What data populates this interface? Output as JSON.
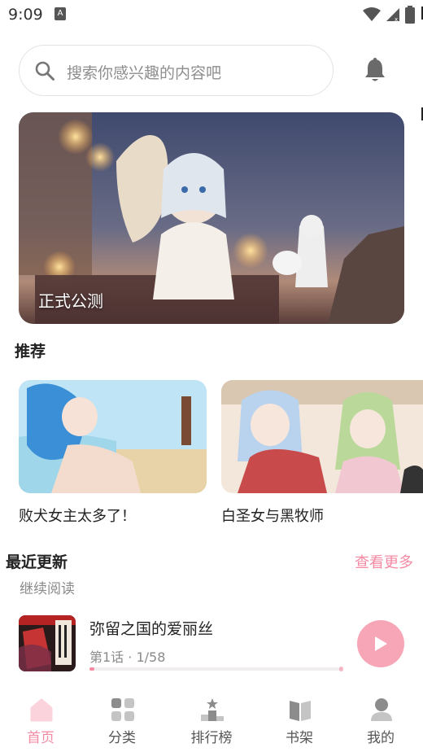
{
  "status_bar": {
    "time": "9:09"
  },
  "search": {
    "placeholder": "搜索你感兴趣的内容吧"
  },
  "banner": {
    "title": "正式公测"
  },
  "recommend": {
    "title": "推荐",
    "items": [
      {
        "title": "败犬女主太多了！"
      },
      {
        "title": "白圣女与黑牧师"
      }
    ]
  },
  "recent": {
    "title": "最近更新",
    "see_more": "查看更多",
    "continue_label": "继续阅读",
    "item": {
      "title": "弥留之国的爱丽丝",
      "progress_text": "第1话 · 1/58",
      "progress_fraction": 0.017
    }
  },
  "nav": {
    "items": [
      {
        "label": "首页",
        "icon": "home-icon",
        "active": true
      },
      {
        "label": "分类",
        "icon": "category-icon",
        "active": false
      },
      {
        "label": "排行榜",
        "icon": "ranking-icon",
        "active": false
      },
      {
        "label": "书架",
        "icon": "bookshelf-icon",
        "active": false
      },
      {
        "label": "我的",
        "icon": "profile-icon",
        "active": false
      }
    ]
  },
  "colors": {
    "accent": "#f48aa3",
    "accent_light": "#f6a6b6",
    "text_primary": "#222222",
    "text_secondary": "#8a8a8a"
  }
}
